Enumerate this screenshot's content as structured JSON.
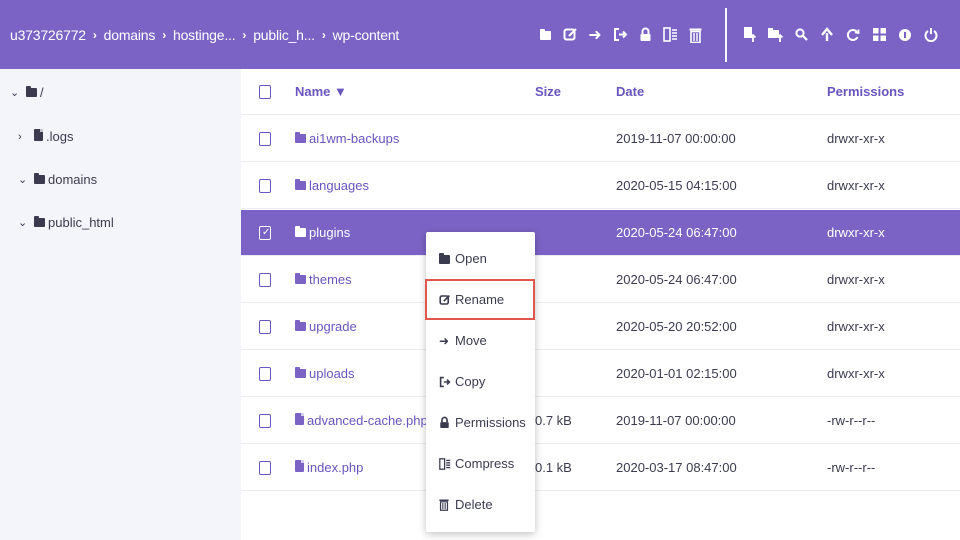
{
  "breadcrumb": [
    "u373726772",
    "domains",
    "hostinge...",
    "public_h...",
    "wp-content"
  ],
  "toolbar": {
    "left_icons": [
      "new-folder-icon",
      "rename-icon",
      "move-icon",
      "copy-icon",
      "permissions-lock-icon",
      "compress-icon",
      "delete-icon"
    ],
    "right_icons": [
      "upload-file-icon",
      "upload-folder-icon",
      "search-icon",
      "download-icon",
      "refresh-icon",
      "grid-view-icon",
      "info-icon",
      "power-icon"
    ]
  },
  "sidebar": {
    "root_label": "/",
    "items": [
      {
        "label": ".logs",
        "icon": "file-stack-icon"
      },
      {
        "label": "domains",
        "icon": "folder-open-icon"
      },
      {
        "label": "public_html",
        "icon": "web-folder-icon"
      }
    ]
  },
  "table": {
    "headers": {
      "name": "Name ▼",
      "size": "Size",
      "date": "Date",
      "permissions": "Permissions"
    },
    "rows": [
      {
        "name": "ai1wm-backups",
        "type": "folder",
        "size": "",
        "date": "2019-11-07 00:00:00",
        "permissions": "drwxr-xr-x",
        "selected": false
      },
      {
        "name": "languages",
        "type": "folder",
        "size": "",
        "date": "2020-05-15 04:15:00",
        "permissions": "drwxr-xr-x",
        "selected": false
      },
      {
        "name": "plugins",
        "type": "folder",
        "size": "",
        "date": "2020-05-24 06:47:00",
        "permissions": "drwxr-xr-x",
        "selected": true
      },
      {
        "name": "themes",
        "type": "folder",
        "size": "",
        "date": "2020-05-24 06:47:00",
        "permissions": "drwxr-xr-x",
        "selected": false
      },
      {
        "name": "upgrade",
        "type": "folder",
        "size": "",
        "date": "2020-05-20 20:52:00",
        "permissions": "drwxr-xr-x",
        "selected": false
      },
      {
        "name": "uploads",
        "type": "folder",
        "size": "",
        "date": "2020-01-01 02:15:00",
        "permissions": "drwxr-xr-x",
        "selected": false
      },
      {
        "name": "advanced-cache.php",
        "type": "file",
        "size": "0.7 kB",
        "date": "2019-11-07 00:00:00",
        "permissions": "-rw-r--r--",
        "selected": false
      },
      {
        "name": "index.php",
        "type": "file",
        "size": "0.1 kB",
        "date": "2020-03-17 08:47:00",
        "permissions": "-rw-r--r--",
        "selected": false
      }
    ]
  },
  "context_menu": {
    "items": [
      {
        "label": "Open",
        "icon": "folder-open-icon",
        "active": false
      },
      {
        "label": "Rename",
        "icon": "rename-icon",
        "active": true
      },
      {
        "label": "Move",
        "icon": "move-arrow-icon",
        "active": false
      },
      {
        "label": "Copy",
        "icon": "copy-icon",
        "active": false
      },
      {
        "label": "Permissions",
        "icon": "lock-icon",
        "active": false
      },
      {
        "label": "Compress",
        "icon": "compress-icon",
        "active": false
      },
      {
        "label": "Delete",
        "icon": "trash-icon",
        "active": false
      }
    ]
  },
  "colors": {
    "accent": "#7b63c6",
    "highlight_border": "#e2574c"
  }
}
